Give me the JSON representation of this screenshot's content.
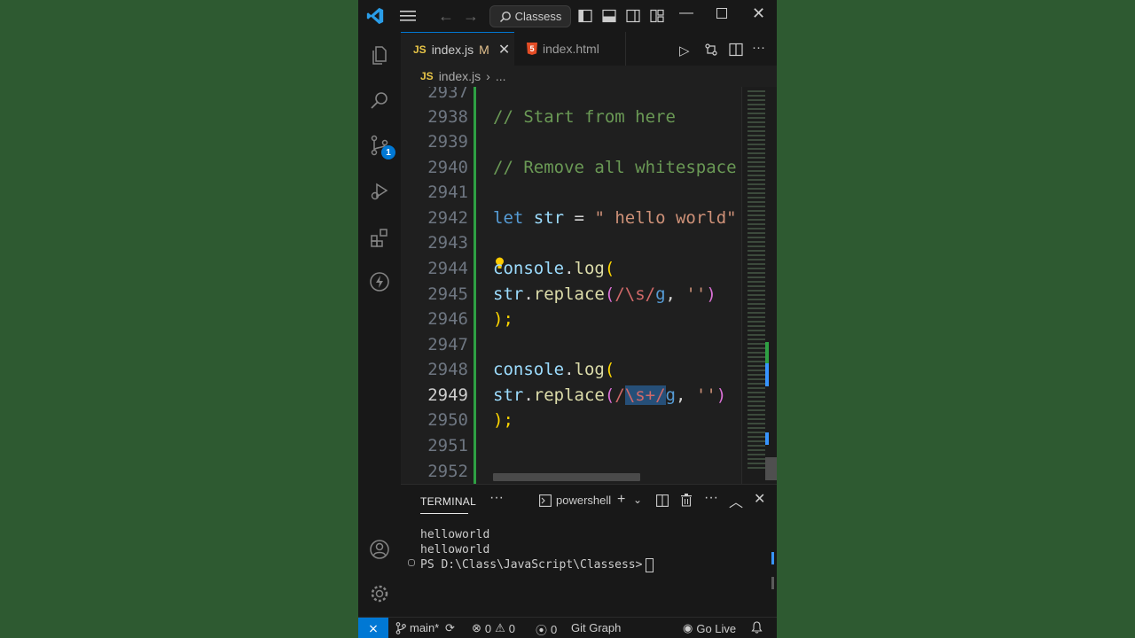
{
  "titlebar": {
    "search_label": "Classess",
    "icons": [
      "vscode-logo-icon",
      "menu-icon",
      "arrow-left-icon",
      "arrow-right-icon",
      "search-icon",
      "toggle-primary-sidebar-icon",
      "toggle-panel-icon",
      "toggle-secondary-sidebar-icon",
      "customize-layout-icon",
      "minimize-icon",
      "maximize-icon",
      "close-icon"
    ]
  },
  "activity_bar": {
    "items": [
      "explorer",
      "search",
      "source-control",
      "run-and-debug",
      "extensions",
      "thunder-client"
    ],
    "source_control_badge": "1",
    "bottom_items": [
      "accounts",
      "manage"
    ]
  },
  "tabs": [
    {
      "icon_text": "JS",
      "label": "index.js",
      "modified": "M",
      "active": true
    },
    {
      "icon_text": "5",
      "label": "index.html",
      "active": false
    }
  ],
  "breadcrumb": {
    "icon_text": "JS",
    "file": "index.js",
    "rest": "..."
  },
  "editor": {
    "line_numbers": [
      "2937",
      "2938",
      "2939",
      "2940",
      "2941",
      "2942",
      "2943",
      "2944",
      "2945",
      "2946",
      "2947",
      "2948",
      "2949",
      "2950",
      "2951",
      "2952"
    ],
    "current_line": "2949",
    "tokens": {
      "l2938": "// Start from here",
      "l2940": "// Remove all whitespace",
      "l2942_kw": "let",
      "l2942_var": "str",
      "l2942_eq": " = ",
      "l2942_str": "\" hello world\"",
      "log_obj": "console",
      "log_dot": ".",
      "log_fn": "log",
      "open_paren": "(",
      "str_var": "str",
      "replace_fn": "replace",
      "l2945_regex": "/\\s/",
      "flag": "g",
      "comma": ", ",
      "empty_str": "''",
      "close_paren": ")",
      "close_stmt": ");",
      "l2949_rx_open": "/",
      "l2949_rx_sel": "\\s+/",
      "l2949_flag": "g"
    }
  },
  "panel": {
    "tab_label": "TERMINAL",
    "more": "···",
    "shell_label": "powershell",
    "output": [
      "helloworld",
      "helloworld"
    ],
    "prompt": "PS D:\\Class\\JavaScript\\Classess>"
  },
  "statusbar": {
    "branch": "main*",
    "errors": "0",
    "warnings": "0",
    "ports": "0",
    "git_graph": "Git Graph",
    "go_live": "Go Live"
  },
  "colors": {
    "background": "#2e5a31",
    "accent": "#0078d4",
    "diff_added": "#2ea043",
    "comment": "#6a9955",
    "keyword": "#569cd6",
    "string": "#ce9178"
  }
}
